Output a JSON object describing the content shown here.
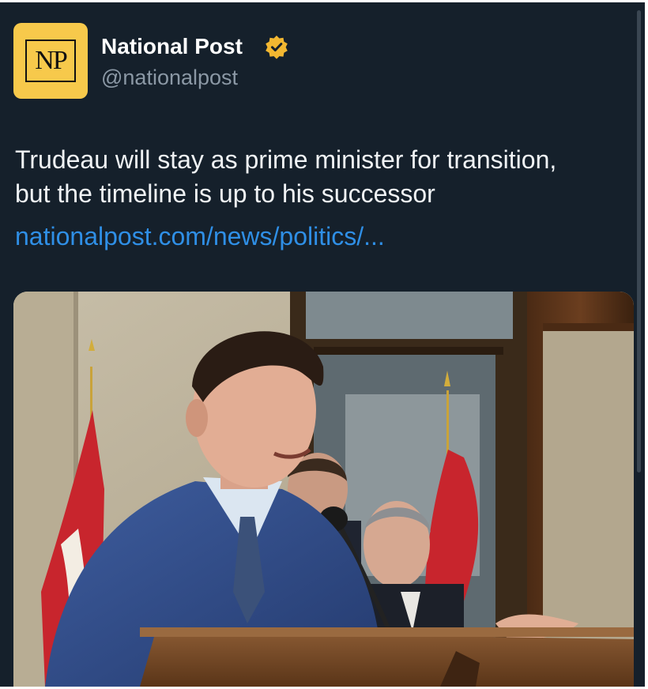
{
  "account": {
    "logo_text": "NP",
    "display_name": "National Post",
    "handle": "@nationalpost",
    "verified_icon": "verified-badge-icon",
    "logo_color": "#f7c94b",
    "badge_color": "#f2b731"
  },
  "tweet": {
    "text_lines": [
      "Trudeau will stay as prime minister for transition,",
      "but the timeline is up to his successor"
    ],
    "link": "nationalpost.com/news/politics/..."
  },
  "media": {
    "type": "photo"
  },
  "colors": {
    "background": "#15202b",
    "text": "#f0f3f5",
    "secondary_text": "#8b98a5",
    "link": "#2f8fe6"
  }
}
